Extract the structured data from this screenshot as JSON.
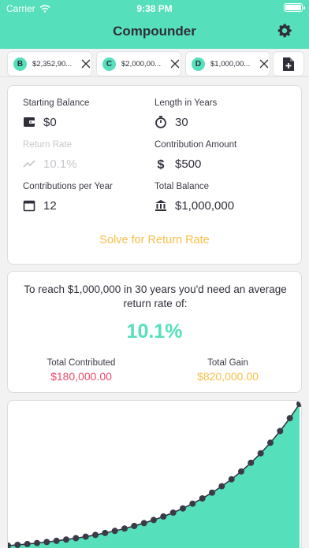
{
  "status": {
    "carrier": "Carrier",
    "time": "9:38 PM"
  },
  "app": {
    "title": "Compounder",
    "accent_color": "#55e0bb",
    "warn_color": "#f5c04a",
    "negative_color": "#ee4a6a"
  },
  "tabs": [
    {
      "letter": "B",
      "amount": "$2,352,90..."
    },
    {
      "letter": "C",
      "amount": "$2,000,00..."
    },
    {
      "letter": "D",
      "amount": "$1,000,00..."
    }
  ],
  "inputs": {
    "starting_balance": {
      "label": "Starting Balance",
      "value": "$0",
      "icon": "wallet-icon"
    },
    "length_years": {
      "label": "Length in Years",
      "value": "30",
      "icon": "stopwatch-icon"
    },
    "return_rate": {
      "label": "Return Rate",
      "value": "10.1%",
      "icon": "trend-icon"
    },
    "contribution_amount": {
      "label": "Contribution Amount",
      "value": "$500",
      "icon": "dollar-icon"
    },
    "contributions_per_year": {
      "label": "Contributions per Year",
      "value": "12",
      "icon": "calendar-icon"
    },
    "total_balance": {
      "label": "Total Balance",
      "value": "$1,000,000",
      "icon": "bank-icon"
    }
  },
  "solve_label": "Solve for Return Rate",
  "result": {
    "text": "To reach $1,000,000 in 30 years you'd need an average return rate of:",
    "rate": "10.1%",
    "total_contributed_label": "Total Contributed",
    "total_contributed_value": "$180,000.00",
    "total_gain_label": "Total Gain",
    "total_gain_value": "$820,000.00"
  }
}
